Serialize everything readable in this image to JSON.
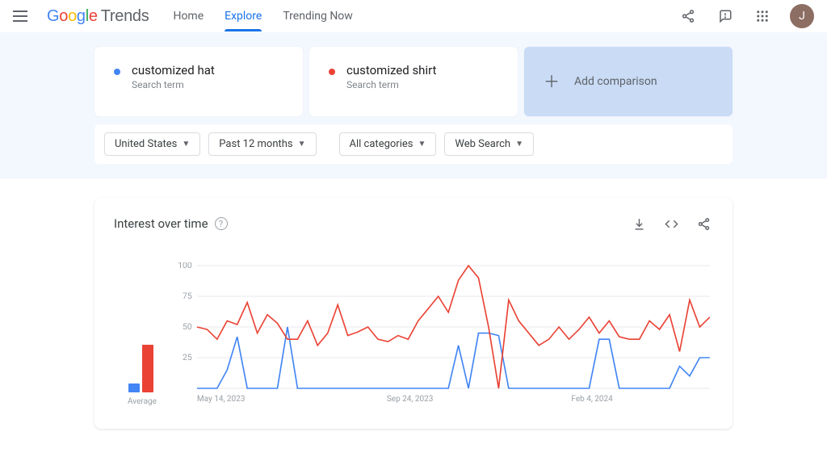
{
  "header": {
    "product": "Trends",
    "nav": [
      "Home",
      "Explore",
      "Trending Now"
    ],
    "active_nav_index": 1,
    "avatar_initial": "J"
  },
  "compare": {
    "terms": [
      {
        "label": "customized hat",
        "sub": "Search term",
        "color": "#4285F4"
      },
      {
        "label": "customized shirt",
        "sub": "Search term",
        "color": "#EA4335"
      }
    ],
    "add_label": "Add comparison"
  },
  "filters": {
    "region": "United States",
    "timeframe": "Past 12 months",
    "category": "All categories",
    "search_type": "Web Search"
  },
  "panel": {
    "title": "Interest over time"
  },
  "chart_data": {
    "type": "line",
    "ylim": [
      0,
      100
    ],
    "yticks": [
      25,
      50,
      75,
      100
    ],
    "x_tick_labels": [
      "May 14, 2023",
      "Sep 24, 2023",
      "Feb 4, 2024"
    ],
    "average": {
      "customized hat": 9,
      "customized shirt": 49
    },
    "series": [
      {
        "name": "customized hat",
        "color": "#4285F4",
        "values": [
          0,
          0,
          0,
          15,
          42,
          0,
          0,
          0,
          0,
          50,
          0,
          0,
          0,
          0,
          0,
          0,
          0,
          0,
          0,
          0,
          0,
          0,
          0,
          0,
          0,
          0,
          35,
          0,
          45,
          45,
          43,
          0,
          0,
          0,
          0,
          0,
          0,
          0,
          0,
          0,
          40,
          40,
          0,
          0,
          0,
          0,
          0,
          0,
          18,
          10,
          25,
          25
        ]
      },
      {
        "name": "customized shirt",
        "color": "#EA4335",
        "values": [
          50,
          48,
          40,
          55,
          52,
          70,
          45,
          60,
          53,
          40,
          40,
          55,
          35,
          45,
          68,
          43,
          46,
          50,
          40,
          38,
          43,
          40,
          55,
          65,
          75,
          62,
          88,
          100,
          90,
          50,
          0,
          72,
          55,
          45,
          35,
          40,
          50,
          40,
          48,
          58,
          45,
          55,
          42,
          40,
          40,
          55,
          48,
          60,
          30,
          72,
          50,
          58
        ]
      }
    ]
  }
}
